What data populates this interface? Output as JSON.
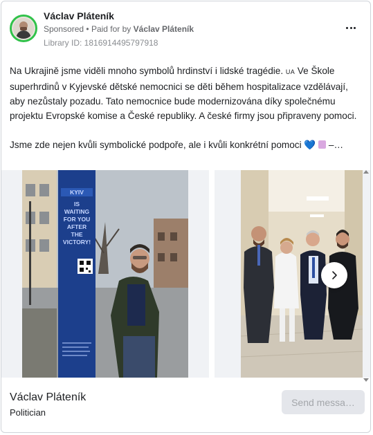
{
  "ad": {
    "page_name": "Václav Pláteník",
    "sponsored_label": "Sponsored",
    "separator": "•",
    "paid_for_label": "Paid for by",
    "paid_for_name": "Václav Pláteník",
    "library_id": "Library ID: 1816914495797918",
    "more_icon": "more-horizontal-icon"
  },
  "body": {
    "p1_a": "Na Ukrajině jsme viděli mnoho symbolů hrdinství i lidské tragédie. ",
    "p1_flag": "UA",
    "p1_b": " Ve Škole superhrdinů v Kyjevské dětské nemocnici se děti během hospitalizace vzdělávají, aby nezůstaly pozadu. Tato nemocnice bude modernizována díky společnému projektu Evropské komise a České republiky. A české firmy jsou připraveny pomoci.",
    "p2_a": "Jsme zde nejen kvůli symbolické podpoře, ale i kvůli konkrétní pomoci ",
    "p2_heart": "💙",
    "p2_tail": " –…"
  },
  "carousel": {
    "poster_text": [
      "KYIV",
      "IS",
      "WAITING",
      "FOR YOU",
      "AFTER",
      "THE",
      "VICTORY!"
    ],
    "next_icon": "chevron-right-icon"
  },
  "footer": {
    "name": "Václav Pláteník",
    "category": "Politician",
    "send_button": "Send messa…"
  },
  "colors": {
    "avatar_ring": "#31c24a",
    "send_button_bg": "#e4e6eb",
    "poster_blue": "#1c3f8c"
  }
}
